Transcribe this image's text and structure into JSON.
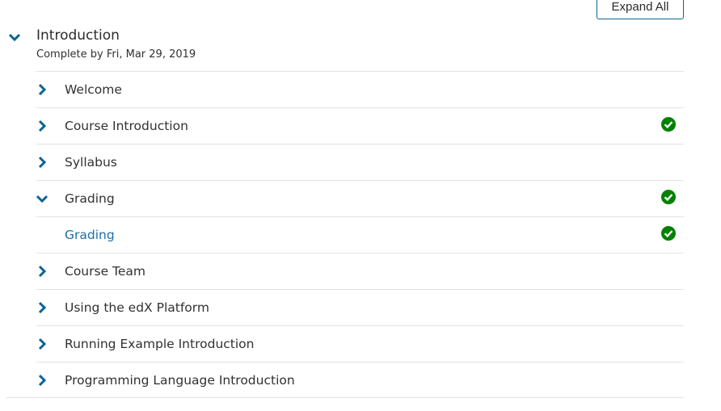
{
  "toolbar": {
    "expand_all_label": "Expand All"
  },
  "section": {
    "title": "Introduction",
    "due": "Complete by Fri, Mar 29, 2019"
  },
  "colors": {
    "accent": "#0a6594",
    "link": "#1e6fa5",
    "complete": "#008100",
    "divider": "#e1e3e5"
  },
  "subsections": [
    {
      "label": "Welcome",
      "expanded": false,
      "complete": false
    },
    {
      "label": "Course Introduction",
      "expanded": false,
      "complete": true
    },
    {
      "label": "Syllabus",
      "expanded": false,
      "complete": false
    },
    {
      "label": "Grading",
      "expanded": true,
      "complete": true,
      "units": [
        {
          "label": "Grading",
          "complete": true
        }
      ]
    },
    {
      "label": "Course Team",
      "expanded": false,
      "complete": false
    },
    {
      "label": "Using the edX Platform",
      "expanded": false,
      "complete": false
    },
    {
      "label": "Running Example Introduction",
      "expanded": false,
      "complete": false
    },
    {
      "label": "Programming Language Introduction",
      "expanded": false,
      "complete": false
    }
  ]
}
